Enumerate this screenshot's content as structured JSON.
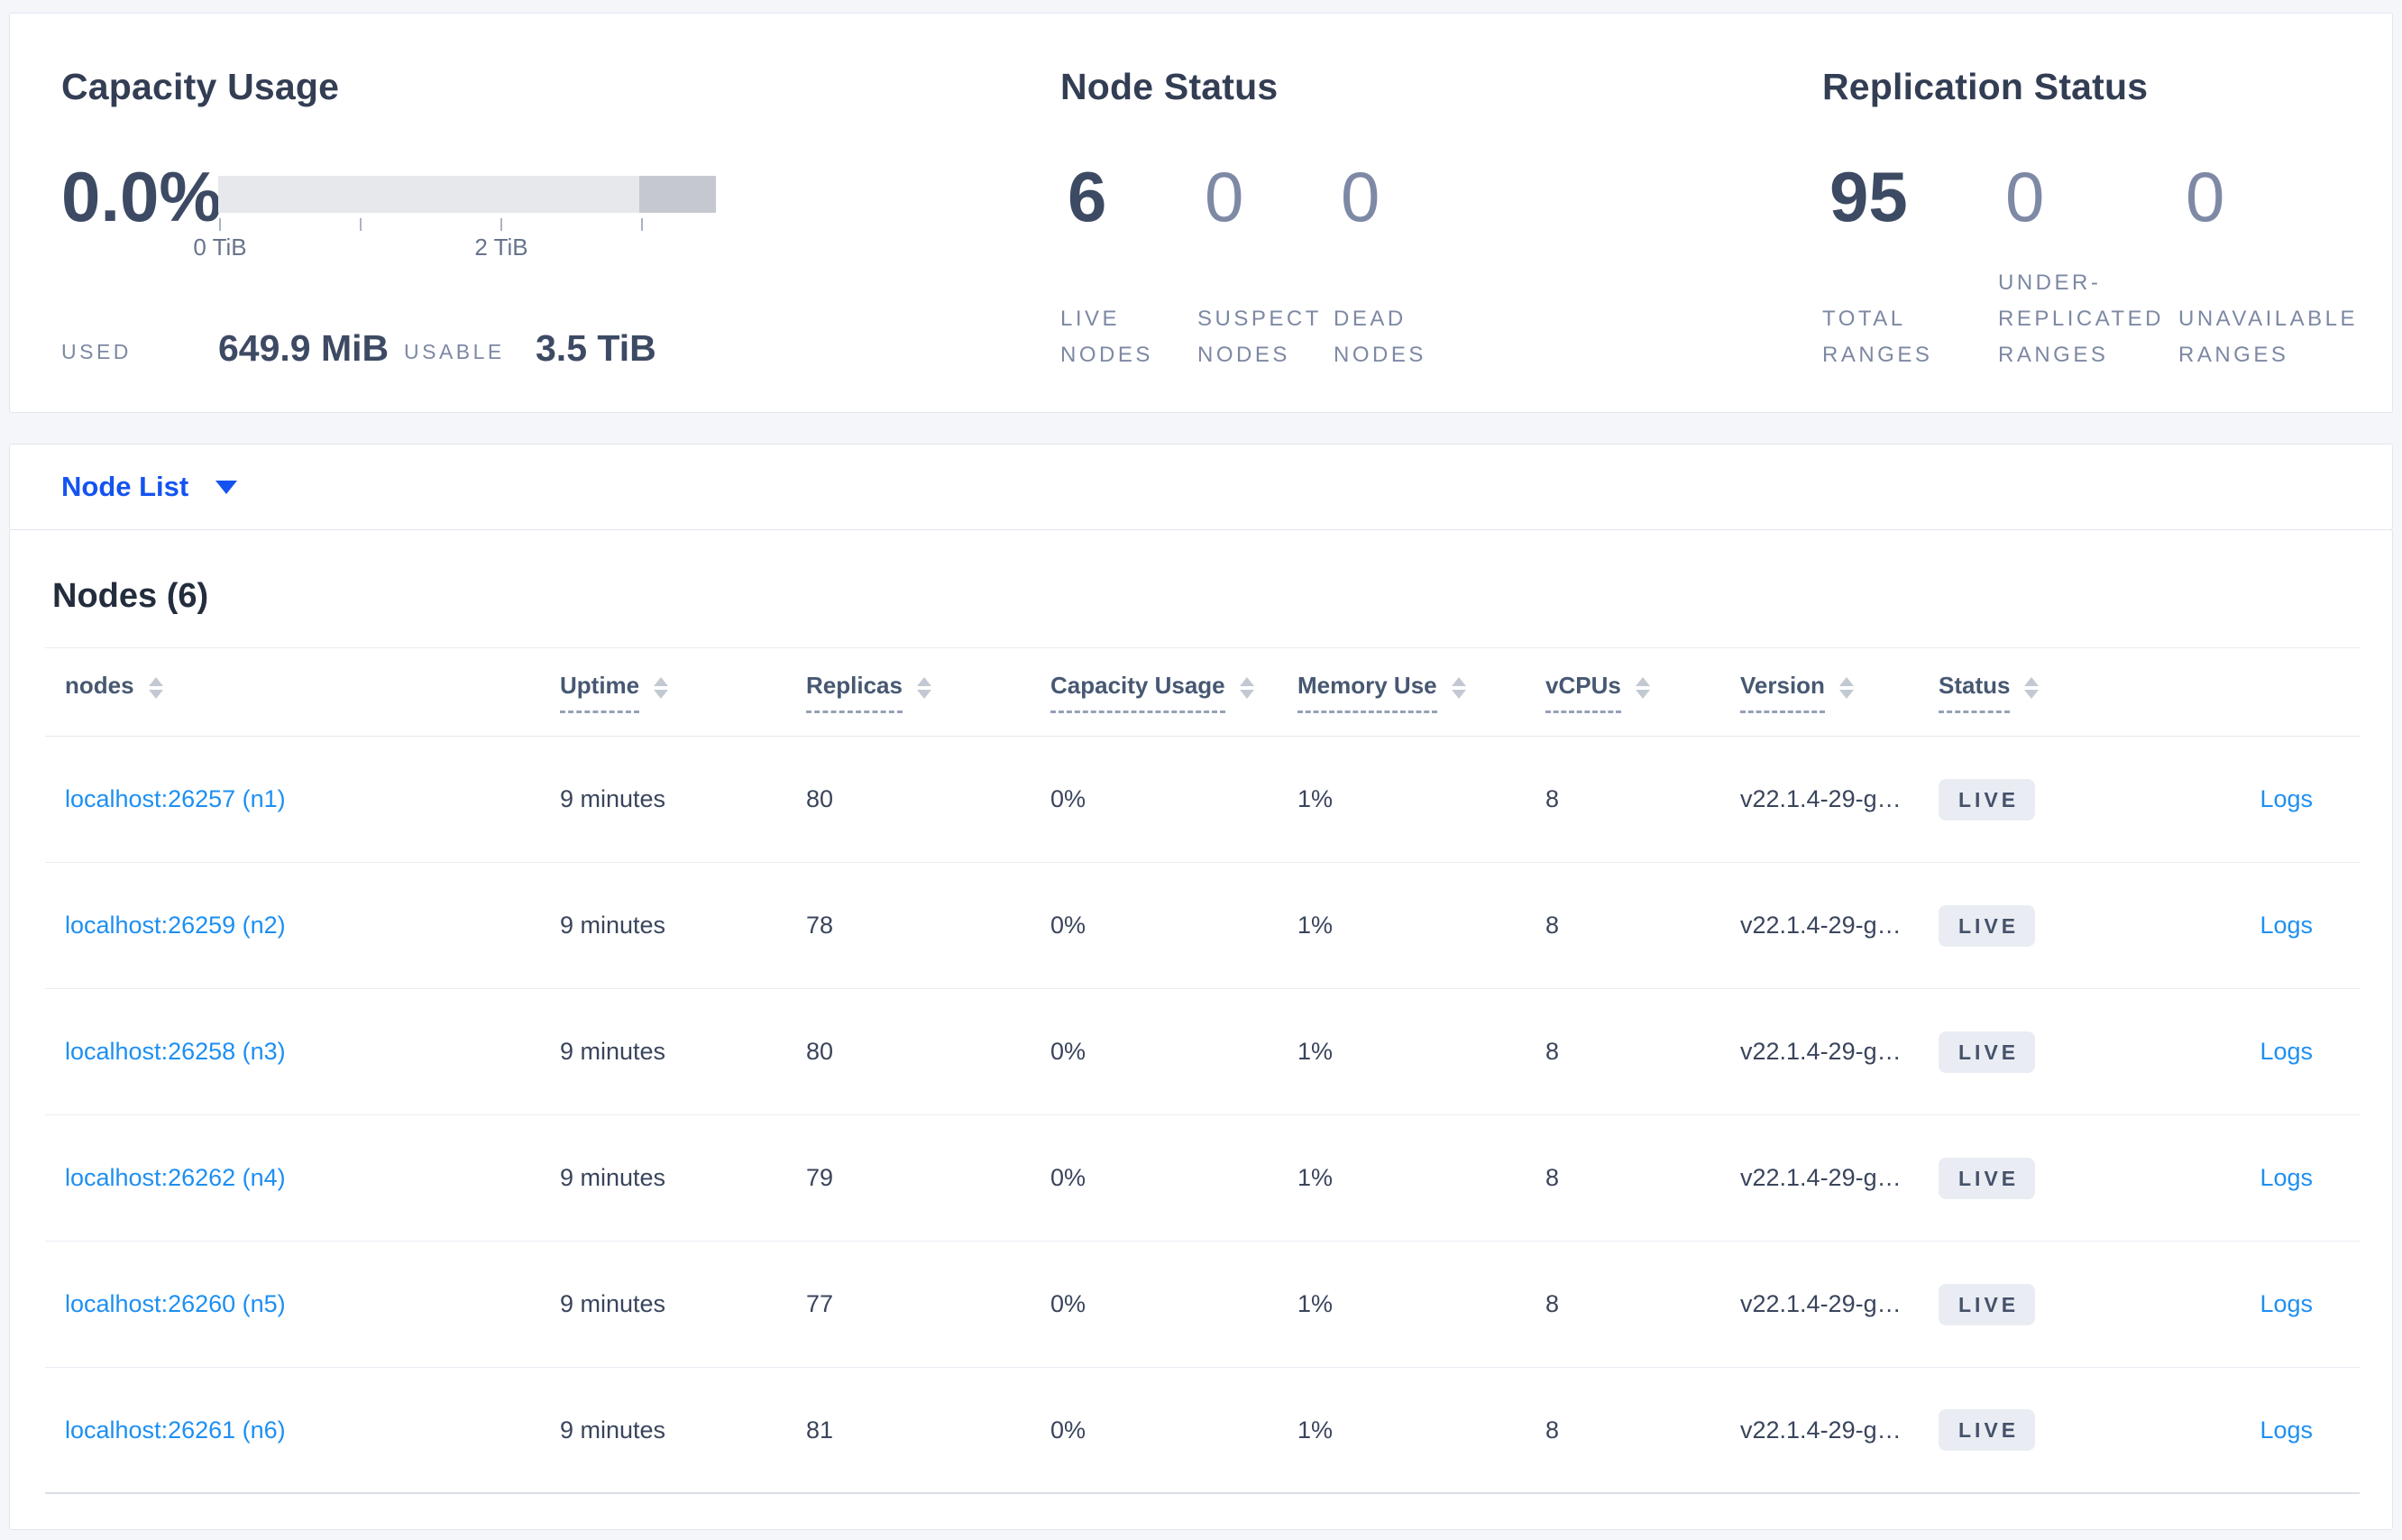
{
  "colors": {
    "accent_blue": "#1453f0",
    "link_blue": "#1d8ff2",
    "heading": "#333e54",
    "muted_stat": "#7e89a6",
    "badge_bg": "#e9edf3",
    "gauge_track": "#e6e8ec",
    "gauge_segment": "#c5c9cf"
  },
  "summary": {
    "capacity": {
      "title": "Capacity Usage",
      "percent": "0.0%",
      "tick_labels": [
        "0 TiB",
        "2 TiB"
      ],
      "used_label": "USED",
      "used_value": "649.9 MiB",
      "usable_label": "USABLE",
      "usable_value": "3.5 TiB"
    },
    "node_status": {
      "title": "Node Status",
      "stats": [
        {
          "value": "6",
          "label": "LIVE NODES"
        },
        {
          "value": "0",
          "label": "SUSPECT NODES"
        },
        {
          "value": "0",
          "label": "DEAD NODES"
        }
      ]
    },
    "replication": {
      "title": "Replication Status",
      "stats": [
        {
          "value": "95",
          "label": "TOTAL RANGES"
        },
        {
          "value": "0",
          "label": "UNDER-REPLICATED RANGES"
        },
        {
          "value": "0",
          "label": "UNAVAILABLE RANGES"
        }
      ]
    }
  },
  "view_selector": {
    "label": "Node List"
  },
  "nodes": {
    "title": "Nodes (6)",
    "headers": [
      "nodes",
      "Uptime",
      "Replicas",
      "Capacity Usage",
      "Memory Use",
      "vCPUs",
      "Version",
      "Status"
    ],
    "rows": [
      {
        "node": "localhost:26257 (n1)",
        "uptime": "9 minutes",
        "replicas": "80",
        "capacity": "0%",
        "memory": "1%",
        "vcpus": "8",
        "version": "v22.1.4-29-g…",
        "status": "LIVE",
        "logs": "Logs"
      },
      {
        "node": "localhost:26259 (n2)",
        "uptime": "9 minutes",
        "replicas": "78",
        "capacity": "0%",
        "memory": "1%",
        "vcpus": "8",
        "version": "v22.1.4-29-g…",
        "status": "LIVE",
        "logs": "Logs"
      },
      {
        "node": "localhost:26258 (n3)",
        "uptime": "9 minutes",
        "replicas": "80",
        "capacity": "0%",
        "memory": "1%",
        "vcpus": "8",
        "version": "v22.1.4-29-g…",
        "status": "LIVE",
        "logs": "Logs"
      },
      {
        "node": "localhost:26262 (n4)",
        "uptime": "9 minutes",
        "replicas": "79",
        "capacity": "0%",
        "memory": "1%",
        "vcpus": "8",
        "version": "v22.1.4-29-g…",
        "status": "LIVE",
        "logs": "Logs"
      },
      {
        "node": "localhost:26260 (n5)",
        "uptime": "9 minutes",
        "replicas": "77",
        "capacity": "0%",
        "memory": "1%",
        "vcpus": "8",
        "version": "v22.1.4-29-g…",
        "status": "LIVE",
        "logs": "Logs"
      },
      {
        "node": "localhost:26261 (n6)",
        "uptime": "9 minutes",
        "replicas": "81",
        "capacity": "0%",
        "memory": "1%",
        "vcpus": "8",
        "version": "v22.1.4-29-g…",
        "status": "LIVE",
        "logs": "Logs"
      }
    ]
  }
}
